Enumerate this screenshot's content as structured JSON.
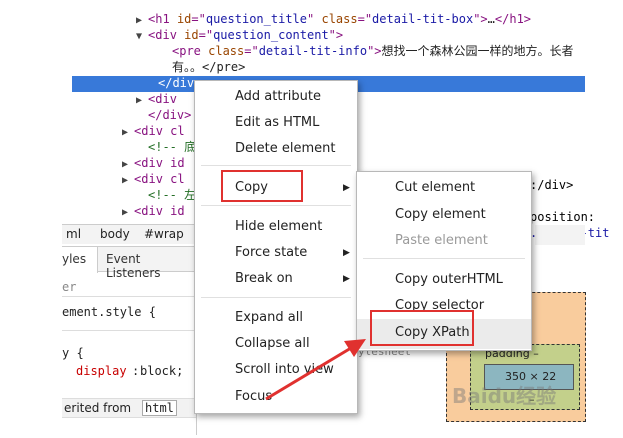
{
  "dom_tree": {
    "lines": [
      {
        "indent": "▶",
        "parts": [
          [
            "tag",
            "<h1 "
          ],
          [
            "attr",
            "id"
          ],
          [
            "tag",
            "=\""
          ],
          [
            "val",
            "question_title"
          ],
          [
            "tag",
            "\" "
          ],
          [
            "attr",
            "class"
          ],
          [
            "tag",
            "=\""
          ],
          [
            "val",
            "detail-tit-box"
          ],
          [
            "tag",
            "\">"
          ],
          [
            "txt",
            "…"
          ],
          [
            "tag",
            "</h1>"
          ]
        ]
      },
      {
        "indent": "▼",
        "parts": [
          [
            "tag",
            "<div "
          ],
          [
            "attr",
            "id"
          ],
          [
            "tag",
            "=\""
          ],
          [
            "val",
            "question_content"
          ],
          [
            "tag",
            "\">"
          ]
        ]
      },
      {
        "indent": "",
        "parts": [
          [
            "tag",
            "<pre "
          ],
          [
            "attr",
            "class"
          ],
          [
            "tag",
            "=\""
          ],
          [
            "val",
            "detail-tit-info"
          ],
          [
            "tag",
            "\">"
          ],
          [
            "txt",
            "想找一个森林公园一样的地方。长者"
          ]
        ]
      },
      {
        "indent": "",
        "parts": [
          [
            "txt",
            "有。。</pre>"
          ]
        ]
      },
      {
        "indent": "",
        "parts": [
          [
            "txt",
            "</div>"
          ]
        ]
      },
      {
        "indent": "▶",
        "parts": [
          [
            "tag",
            "<div"
          ]
        ]
      },
      {
        "indent": "",
        "parts": [
          [
            "tag",
            "</div>"
          ]
        ]
      },
      {
        "indent": "▶",
        "parts": [
          [
            "tag",
            "<div cl"
          ]
        ]
      },
      {
        "indent": "",
        "parts": [
          [
            "cmt",
            "<!-- 底"
          ]
        ]
      },
      {
        "indent": "▶",
        "parts": [
          [
            "tag",
            "<div id"
          ]
        ]
      },
      {
        "indent": "▶",
        "parts": [
          [
            "tag",
            "<div cl"
          ]
        ]
      },
      {
        "indent": "",
        "parts": [
          [
            "cmt",
            "<!-- 左"
          ]
        ]
      },
      {
        "indent": "▶",
        "parts": [
          [
            "tag",
            "<div id"
          ]
        ]
      }
    ],
    "right_fragments": [
      ":/div>",
      "position:",
      ".detail-tit"
    ]
  },
  "breadcrumbs": [
    "ml",
    "body",
    "#wrap"
  ],
  "panel_tabs": [
    "yles",
    "Event Listeners"
  ],
  "styles": {
    "filter": "er",
    "element_style": "ement.style {",
    "rule_open": "y {",
    "prop_name": "display",
    "prop_value": "block;",
    "inherited_label": "erited from",
    "inherited_tag": "html",
    "stylesheet_fragment": "ylesheet"
  },
  "box_model": {
    "padding_label": "padding –",
    "size": "350 × 22",
    "dash": "–"
  },
  "context_menu": {
    "items": [
      "Add attribute",
      "Edit as HTML",
      "Delete element",
      "Copy",
      "Hide element",
      "Force state",
      "Break on",
      "Expand all",
      "Collapse all",
      "Scroll into view",
      "Focus"
    ]
  },
  "submenu": {
    "items": [
      "Cut element",
      "Copy element",
      "Paste element",
      "Copy outerHTML",
      "Copy selector",
      "Copy XPath"
    ]
  },
  "watermark": "Baidu经验",
  "colors": {
    "selection": "#3879d9",
    "highlight_red": "#e0312f",
    "padding_box": "#c3d08b",
    "margin_box": "#f9cc9d",
    "content_box": "#8cb6c0"
  }
}
